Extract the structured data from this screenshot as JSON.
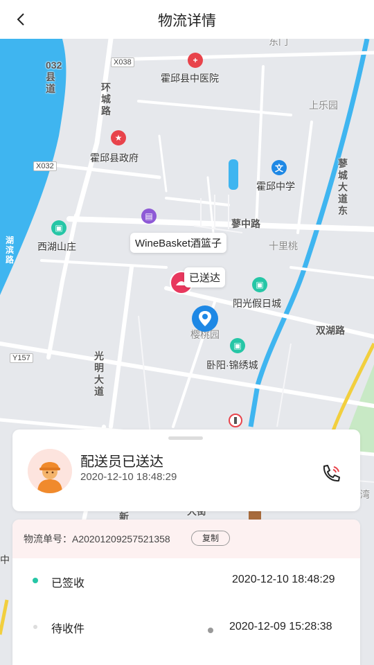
{
  "header": {
    "title": "物流详情",
    "back_icon": "chevron-left-icon"
  },
  "map": {
    "labels": {
      "hospital": "霍邱县中医院",
      "government": "霍邱县政府",
      "school": "霍邱中学",
      "xihu": "西湖山庄",
      "yangguang": "阳光假日城",
      "wolyang": "卧阳·锦绣城",
      "yingtao": "樱桃园",
      "shangle": "上乐园",
      "shilitao": "十里桃",
      "huancheng_road": "环城路",
      "liaozhong_road": "蓼中路",
      "shuanghu_road": "双湖路",
      "guangming_road": "光明大道",
      "liaocheng_road": "蓼城大道东",
      "county_road": "032县道",
      "lakeside": "湖滨路",
      "x038": "X038",
      "x032": "X032",
      "y157": "Y157",
      "top_partial": "东门",
      "left_partial": "中",
      "bottom_partial_1": "新",
      "bottom_partial_2": "大街",
      "right_partial": "华湾"
    },
    "store_bubble": "WineBasket酒篮子",
    "delivered_bubble": "已送达"
  },
  "courier_card": {
    "title": "配送员已送达",
    "time": "2020-12-10 18:48:29"
  },
  "tracking": {
    "order_label": "物流单号：A20201209257521358",
    "copy_label": "复制",
    "events": [
      {
        "status": "已签收",
        "time": "2020-12-10 18:48:29"
      },
      {
        "status": "待收件",
        "time": "2020-12-09 15:28:38"
      }
    ]
  },
  "colors": {
    "accent": "#26c6a6",
    "river": "#3fb5f0",
    "pin": "#1e88e5",
    "store": "#e8385e"
  }
}
